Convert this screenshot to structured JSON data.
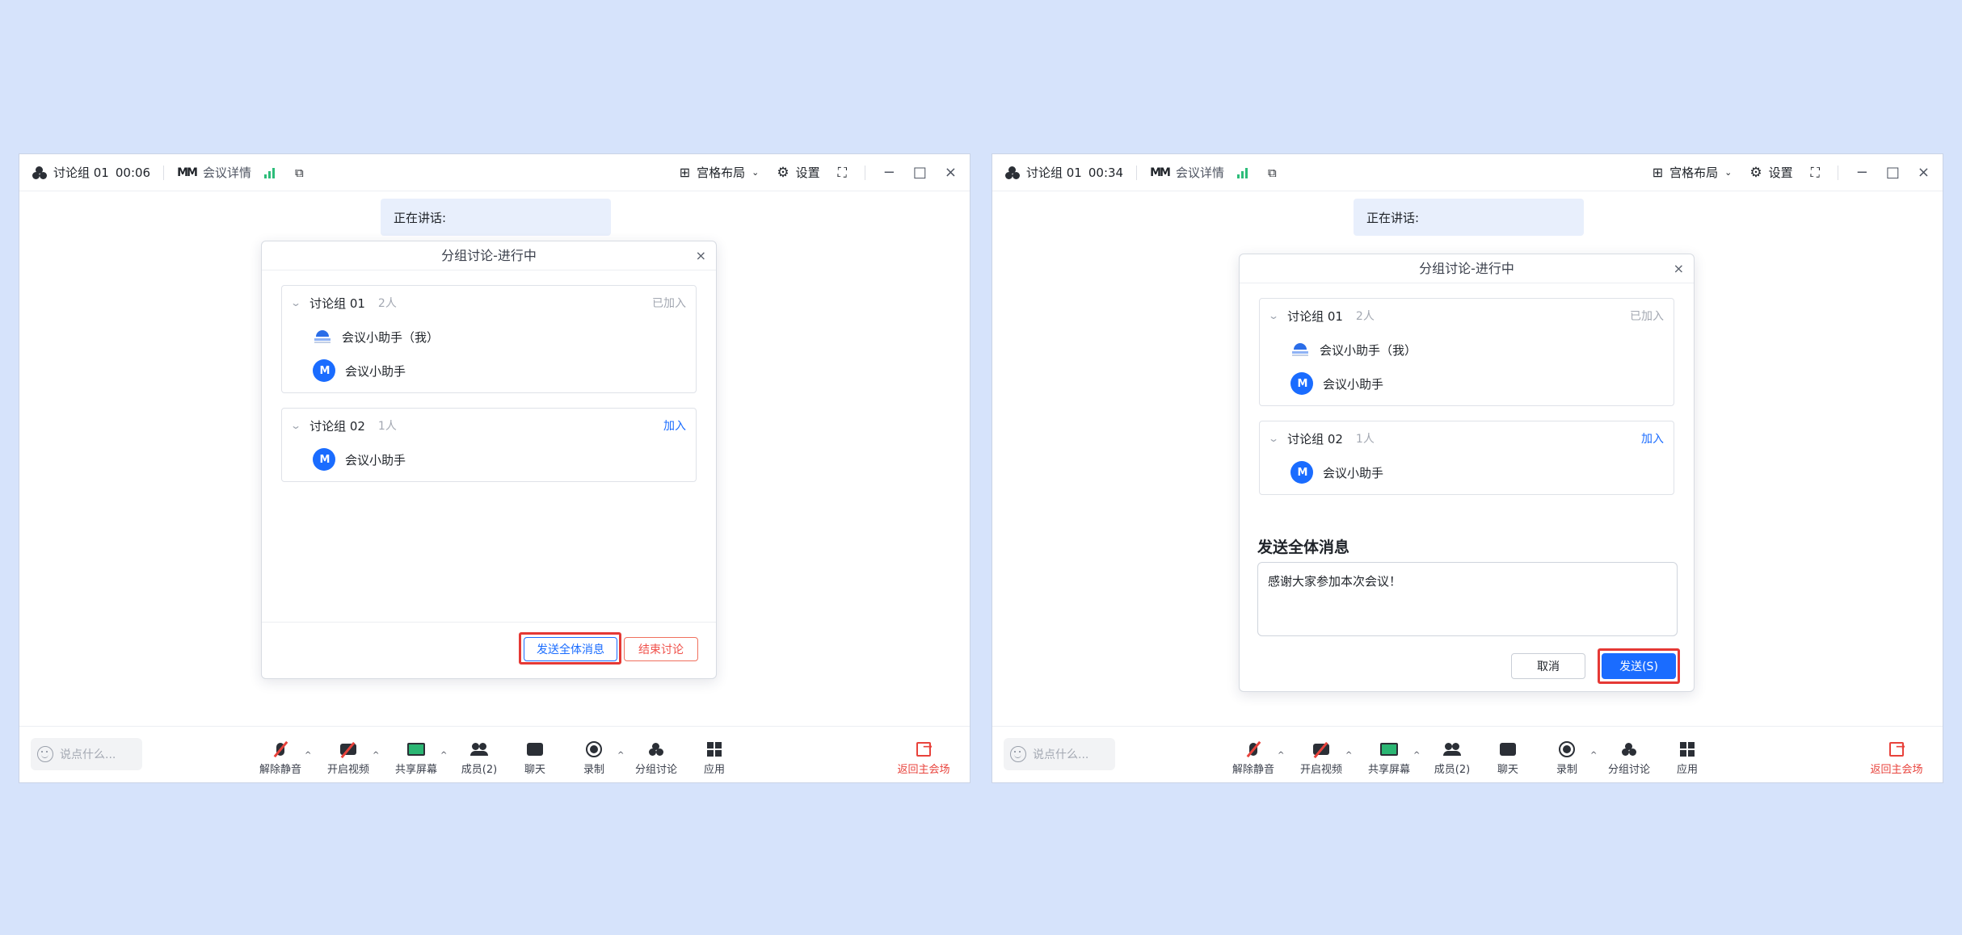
{
  "left": {
    "titlebar": {
      "group_name": "讨论组 01",
      "timer": "00:06",
      "meeting_details": "会议详情",
      "layout": "宫格布局",
      "settings": "设置"
    },
    "speaking_label": "正在讲话:",
    "dialog": {
      "title": "分组讨论-进行中",
      "groups": [
        {
          "name": "讨论组 01",
          "count": "2人",
          "status": "已加入",
          "members": [
            "会议小助手（我）",
            "会议小助手"
          ]
        },
        {
          "name": "讨论组 02",
          "count": "1人",
          "status": "加入",
          "members": [
            "会议小助手"
          ]
        }
      ],
      "broadcast_button": "发送全体消息",
      "end_button": "结束讨论"
    },
    "say_placeholder": "说点什么...",
    "tools": [
      "解除静音",
      "开启视频",
      "共享屏幕",
      "成员(2)",
      "聊天",
      "录制",
      "分组讨论",
      "应用"
    ],
    "exit": "返回主会场"
  },
  "right": {
    "titlebar": {
      "group_name": "讨论组 01",
      "timer": "00:34",
      "meeting_details": "会议详情",
      "layout": "宫格布局",
      "settings": "设置"
    },
    "speaking_label": "正在讲话:",
    "dialog": {
      "title": "分组讨论-进行中",
      "groups": [
        {
          "name": "讨论组 01",
          "count": "2人",
          "status": "已加入",
          "members": [
            "会议小助手（我）",
            "会议小助手"
          ]
        },
        {
          "name": "讨论组 02",
          "count": "1人",
          "status": "加入",
          "members": [
            "会议小助手"
          ]
        }
      ],
      "message_title": "发送全体消息",
      "message_text": "感谢大家参加本次会议！",
      "cancel_button": "取消",
      "send_button": "发送(S)"
    },
    "say_placeholder": "说点什么...",
    "tools": [
      "解除静音",
      "开启视频",
      "共享屏幕",
      "成员(2)",
      "聊天",
      "录制",
      "分组讨论",
      "应用"
    ],
    "exit": "返回主会场"
  },
  "colors": {
    "accent": "#1a6cff",
    "danger": "#e8423b",
    "highlight": "#e53935",
    "background": "#d6e3fb"
  }
}
